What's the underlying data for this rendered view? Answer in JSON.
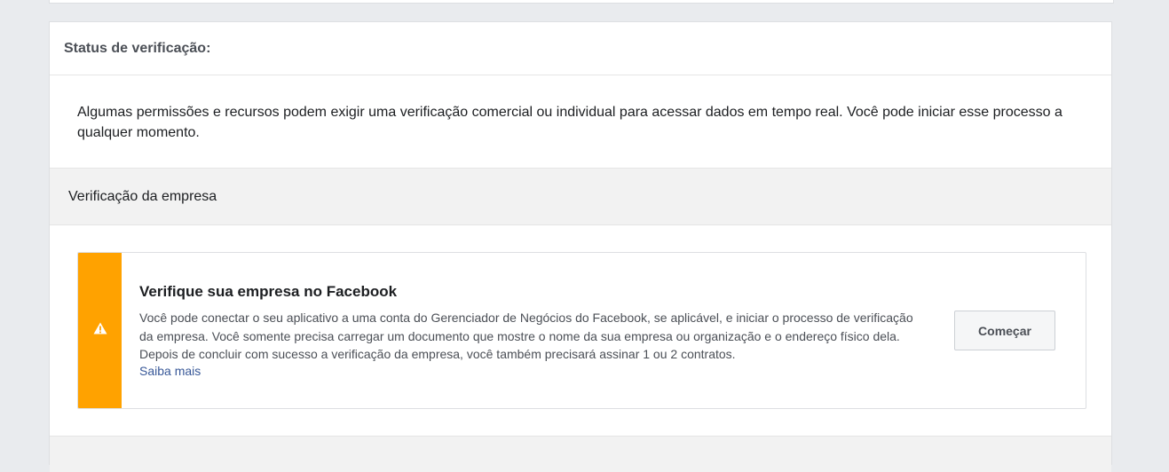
{
  "status_card": {
    "title": "Status de verificação:",
    "intro": "Algumas permissões e recursos podem exigir uma verificação comercial ou individual para acessar dados em tempo real. Você pode iniciar esse processo a qualquer momento."
  },
  "business_verification": {
    "section_title": "Verificação da empresa",
    "notice": {
      "icon": "warning-icon",
      "accent_color": "#ffa200",
      "title": "Verifique sua empresa no Facebook",
      "text": "Você pode conectar o seu aplicativo a uma conta do Gerenciador de Negócios do Facebook, se aplicável, e iniciar o processo de verificação da empresa. Você somente precisa carregar um documento que mostre o nome da sua empresa ou organização e o endereço físico dela. Depois de concluir com sucesso a verificação da empresa, você também precisará assinar 1 ou 2 contratos.",
      "link_label": "Saiba mais",
      "button_label": "Começar"
    }
  }
}
